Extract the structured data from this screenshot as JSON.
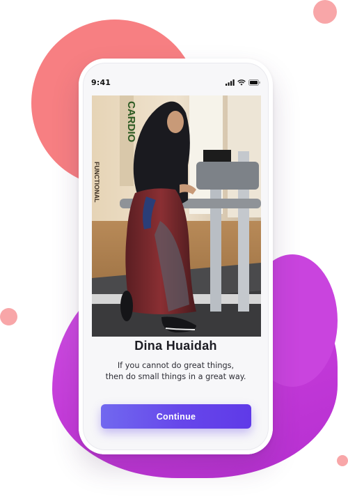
{
  "status_bar": {
    "time": "9:41",
    "icons": [
      "signal-icon",
      "wifi-icon",
      "battery-icon"
    ]
  },
  "profile": {
    "photo_alt": "person-photo",
    "name": "Dina Huaidah",
    "quote_line_1": "If you cannot do great things,",
    "quote_line_2": "then do small things in a great way."
  },
  "actions": {
    "continue_label": "Continue"
  },
  "colors": {
    "accent_start": "#7168ef",
    "accent_end": "#5f3ae8",
    "blob_pink": "#f77f82",
    "blob_purple": "#c43ad9",
    "dot": "#f8a6a8"
  }
}
